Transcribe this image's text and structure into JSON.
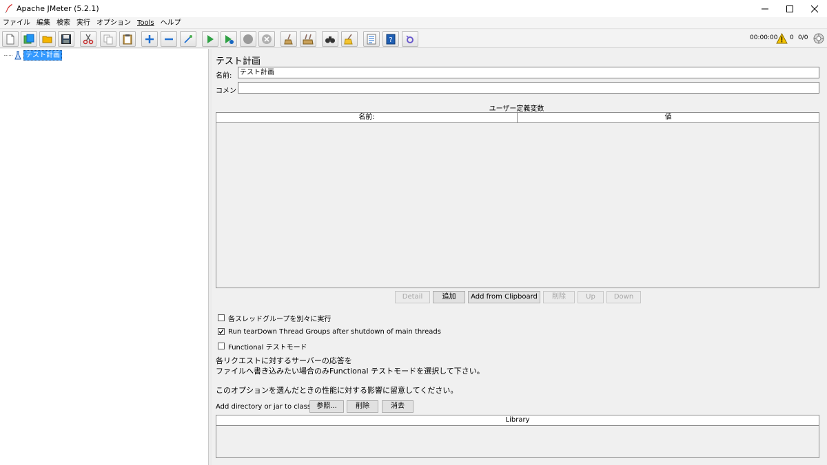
{
  "window": {
    "title": "Apache JMeter (5.2.1)"
  },
  "menu": [
    {
      "label": "ファイル"
    },
    {
      "label": "編集"
    },
    {
      "label": "検索"
    },
    {
      "label": "実行"
    },
    {
      "label": "オプション"
    },
    {
      "label": "Tools"
    },
    {
      "label": "ヘルプ"
    }
  ],
  "toolbar": {
    "elapsed_time": "00:00:00",
    "warning_count": "0",
    "thread_count": "0/0",
    "colors": {
      "start": "#2ea043",
      "stop": "#9a9a9a",
      "add": "#1f6fd1",
      "cut": "#c62828"
    }
  },
  "tree": {
    "root_label": "テスト計画"
  },
  "plan": {
    "title": "テスト計画",
    "name_label": "名前:",
    "name_value": "テスト計画",
    "comment_label": "コメント:",
    "comment_value": "",
    "variables_caption": "ユーザー定義変数",
    "variables_columns": [
      "名前:",
      "値"
    ],
    "buttons": {
      "detail": "Detail",
      "add": "追加",
      "add_clipboard": "Add from Clipboard",
      "delete": "削除",
      "up": "Up",
      "down": "Down"
    },
    "checkboxes": {
      "serialize": {
        "label": "各スレッドグループを別々に実行",
        "checked": false
      },
      "teardown": {
        "label": "Run tearDown Thread Groups after shutdown of main threads",
        "checked": true
      },
      "functional": {
        "label": "Functional テストモード",
        "checked": false
      }
    },
    "note_line1": "各リクエストに対するサーバーの応答を",
    "note_line2": "ファイルへ書き込みたい場合のみFunctional テストモードを選択して下さい。",
    "note_line3": "このオプションを選んだときの性能に対する影響に留意してください。",
    "classpath_label": "Add directory or jar to classpath",
    "classpath_buttons": {
      "browse": "参照...",
      "delete": "削除",
      "clear": "消去"
    },
    "library_column": "Library"
  }
}
